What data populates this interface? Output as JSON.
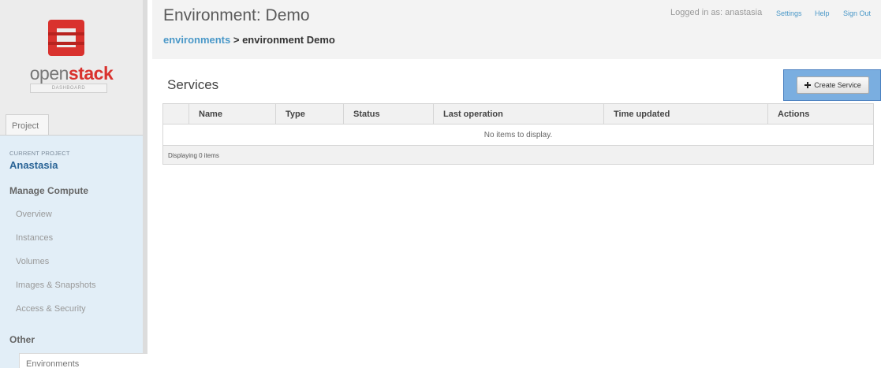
{
  "brand": {
    "logo_icon": "openstack-logo-icon",
    "word_light": "open",
    "word_bold": "stack",
    "subtitle": "DASHBOARD",
    "accent": "#d9322e"
  },
  "sidebar": {
    "tab": "Project",
    "current_project_label": "CURRENT PROJECT",
    "current_project_name": "Anastasia",
    "sections": [
      {
        "title": "Manage Compute",
        "items": [
          "Overview",
          "Instances",
          "Volumes",
          "Images & Snapshots",
          "Access & Security"
        ]
      },
      {
        "title": "Other",
        "items": [
          "Environments"
        ]
      }
    ],
    "active_item": "Environments"
  },
  "header": {
    "title": "Environment: Demo",
    "breadcrumb_link": "environments",
    "breadcrumb_sep": " > ",
    "breadcrumb_current": "environment Demo",
    "logged_in": "Logged in as: anastasia",
    "links": [
      "Settings",
      "Help",
      "Sign Out"
    ],
    "link_color": "#4a98c8"
  },
  "main": {
    "section_title": "Services",
    "create_button": "Create Service",
    "table": {
      "columns": [
        "",
        "Name",
        "Type",
        "Status",
        "Last operation",
        "Time updated",
        "Actions"
      ],
      "empty_message": "No items to display.",
      "footer": "Displaying 0 items"
    }
  }
}
